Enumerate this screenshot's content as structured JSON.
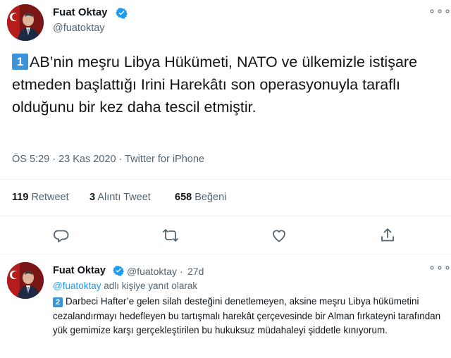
{
  "tweet": {
    "author_name": "Fuat Oktay",
    "handle": "@fuatoktay",
    "badge": "1",
    "text": "AB’nin meşru Libya Hükümeti, NATO ve ülkemizle istişare etmeden başlattığı Irini Harekâtı son operasyonuyla taraflı olduğunu bir kez daha tescil etmiştir.",
    "meta": "ÖS 5:29 · 23 Kas 2020 · Twitter for iPhone",
    "stats": {
      "retweets_count": "119",
      "retweets_label": "Retweet",
      "quotes_count": "3",
      "quotes_label": "Alıntı Tweet",
      "likes_count": "658",
      "likes_label": "Beğeni"
    },
    "actions": [
      "reply-icon",
      "retweet-icon",
      "like-icon",
      "share-icon"
    ]
  },
  "reply": {
    "author_name": "Fuat Oktay",
    "handle": "@fuatoktay",
    "separator": "·",
    "age": "27d",
    "reply_to_mention": "@fuatoktay",
    "reply_to_suffix": "adlı kişiye yanıt olarak",
    "badge": "2",
    "text": "Darbeci Hafter’e gelen silah desteğini denetlemeyen, aksine meşru Libya hükümetini cezalandırmayı hedefleyen bu tartışmalı harekât çerçevesinde bir Alman fırkateyni tarafından yük gemimize karşı gerçekleştirilen bu hukuksuz müdahaleyi şiddetle kınıyorum."
  },
  "colors": {
    "accent": "#1d9bf0",
    "muted": "#536471",
    "text": "#0f1419",
    "badge": "#3b94d9"
  }
}
